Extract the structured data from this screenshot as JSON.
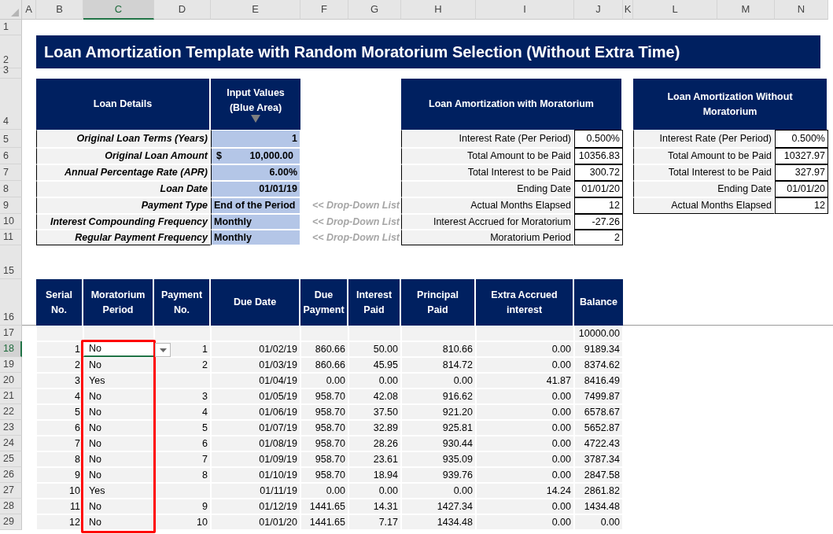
{
  "column_headers": [
    {
      "label": "A",
      "selected": false
    },
    {
      "label": "B",
      "selected": false
    },
    {
      "label": "C",
      "selected": true
    },
    {
      "label": "D",
      "selected": false
    },
    {
      "label": "E",
      "selected": false
    },
    {
      "label": "F",
      "selected": false
    },
    {
      "label": "G",
      "selected": false
    },
    {
      "label": "H",
      "selected": false
    },
    {
      "label": "I",
      "selected": false
    },
    {
      "label": "J",
      "selected": false
    },
    {
      "label": "K",
      "selected": false
    },
    {
      "label": "L",
      "selected": false
    },
    {
      "label": "M",
      "selected": false
    },
    {
      "label": "N",
      "selected": false
    }
  ],
  "row_headers": [
    {
      "label": "1",
      "selected": false
    },
    {
      "label": "2",
      "selected": false
    },
    {
      "label": "3",
      "selected": false
    },
    {
      "label": "4",
      "selected": false
    },
    {
      "label": "5",
      "selected": false
    },
    {
      "label": "6",
      "selected": false
    },
    {
      "label": "7",
      "selected": false
    },
    {
      "label": "8",
      "selected": false
    },
    {
      "label": "9",
      "selected": false
    },
    {
      "label": "10",
      "selected": false
    },
    {
      "label": "11",
      "selected": false
    },
    {
      "label": "15",
      "selected": false
    },
    {
      "label": "16",
      "selected": false
    },
    {
      "label": "17",
      "selected": false
    },
    {
      "label": "18",
      "selected": true
    },
    {
      "label": "19",
      "selected": false
    },
    {
      "label": "20",
      "selected": false
    },
    {
      "label": "21",
      "selected": false
    },
    {
      "label": "22",
      "selected": false
    },
    {
      "label": "23",
      "selected": false
    },
    {
      "label": "24",
      "selected": false
    },
    {
      "label": "25",
      "selected": false
    },
    {
      "label": "26",
      "selected": false
    },
    {
      "label": "27",
      "selected": false
    },
    {
      "label": "28",
      "selected": false
    },
    {
      "label": "29",
      "selected": false
    }
  ],
  "title": "Loan Amortization Template with Random Moratorium Selection (Without Extra Time)",
  "loan_details": {
    "header": "Loan Details",
    "input_header": [
      "Input Values",
      "(Blue Area)"
    ],
    "rows": [
      {
        "label": "Original Loan Terms (Years)",
        "value": "1"
      },
      {
        "label": "Original Loan Amount",
        "currency": "$",
        "value": "10,000.00"
      },
      {
        "label": "Annual Percentage Rate (APR)",
        "value": "6.00%"
      },
      {
        "label": "Loan Date",
        "value": "01/01/19"
      },
      {
        "label": "Payment Type",
        "value": "End of the Period",
        "note": "<< Drop-Down List"
      },
      {
        "label": "Interest Compounding Frequency",
        "value": "Monthly",
        "note": "<< Drop-Down List"
      },
      {
        "label": "Regular Payment Frequency",
        "value": "Monthly",
        "note": "<< Drop-Down List"
      }
    ]
  },
  "with_moratorium": {
    "title": "Loan Amortization with Moratorium",
    "rows": [
      {
        "label": "Interest Rate (Per Period)",
        "value": "0.500%"
      },
      {
        "label": "Total Amount to be Paid",
        "value": "10356.83"
      },
      {
        "label": "Total Interest to be Paid",
        "value": "300.72"
      },
      {
        "label": "Ending Date",
        "value": "01/01/20"
      },
      {
        "label": "Actual Months Elapsed",
        "value": "12"
      },
      {
        "label": "Interest Accrued for Moratorium",
        "value": "-27.26"
      },
      {
        "label": "Moratorium Period",
        "value": "2"
      }
    ]
  },
  "without_moratorium": {
    "title": "Loan Amortization Without Moratorium",
    "rows": [
      {
        "label": "Interest Rate (Per Period)",
        "value": "0.500%"
      },
      {
        "label": "Total Amount to be Paid",
        "value": "10327.97"
      },
      {
        "label": "Total Interest to be Paid",
        "value": "327.97"
      },
      {
        "label": "Ending Date",
        "value": "01/01/20"
      },
      {
        "label": "Actual Months Elapsed",
        "value": "12"
      }
    ]
  },
  "schedule": {
    "columns": [
      {
        "label": [
          "Serial",
          "No."
        ],
        "highlighted": false
      },
      {
        "label": [
          "Moratorium",
          "Period"
        ],
        "highlighted": true
      },
      {
        "label": [
          "Payment",
          "No."
        ],
        "highlighted": false
      },
      {
        "label": [
          "Due Date"
        ],
        "highlighted": false
      },
      {
        "label": [
          "Due",
          "Payment"
        ],
        "highlighted": false
      },
      {
        "label": [
          "Interest",
          "Paid"
        ],
        "highlighted": false
      },
      {
        "label": [
          "Principal",
          "Paid"
        ],
        "highlighted": false
      },
      {
        "label": [
          "Extra Accrued",
          "interest"
        ],
        "highlighted": false
      },
      {
        "label": [
          "Balance"
        ],
        "highlighted": false
      }
    ],
    "opening_balance": "10000.00",
    "rows": [
      {
        "selected": true,
        "cells": [
          "1",
          "No",
          "1",
          "01/02/19",
          "860.66",
          "50.00",
          "810.66",
          "0.00",
          "9189.34"
        ]
      },
      {
        "selected": false,
        "cells": [
          "2",
          "No",
          "2",
          "01/03/19",
          "860.66",
          "45.95",
          "814.72",
          "0.00",
          "8374.62"
        ]
      },
      {
        "selected": false,
        "cells": [
          "3",
          "Yes",
          "",
          "01/04/19",
          "0.00",
          "0.00",
          "0.00",
          "41.87",
          "8416.49"
        ]
      },
      {
        "selected": false,
        "cells": [
          "4",
          "No",
          "3",
          "01/05/19",
          "958.70",
          "42.08",
          "916.62",
          "0.00",
          "7499.87"
        ]
      },
      {
        "selected": false,
        "cells": [
          "5",
          "No",
          "4",
          "01/06/19",
          "958.70",
          "37.50",
          "921.20",
          "0.00",
          "6578.67"
        ]
      },
      {
        "selected": false,
        "cells": [
          "6",
          "No",
          "5",
          "01/07/19",
          "958.70",
          "32.89",
          "925.81",
          "0.00",
          "5652.87"
        ]
      },
      {
        "selected": false,
        "cells": [
          "7",
          "No",
          "6",
          "01/08/19",
          "958.70",
          "28.26",
          "930.44",
          "0.00",
          "4722.43"
        ]
      },
      {
        "selected": false,
        "cells": [
          "8",
          "No",
          "7",
          "01/09/19",
          "958.70",
          "23.61",
          "935.09",
          "0.00",
          "3787.34"
        ]
      },
      {
        "selected": false,
        "cells": [
          "9",
          "No",
          "8",
          "01/10/19",
          "958.70",
          "18.94",
          "939.76",
          "0.00",
          "2847.58"
        ]
      },
      {
        "selected": false,
        "cells": [
          "10",
          "Yes",
          "",
          "01/11/19",
          "0.00",
          "0.00",
          "0.00",
          "14.24",
          "2861.82"
        ]
      },
      {
        "selected": false,
        "cells": [
          "11",
          "No",
          "9",
          "01/12/19",
          "1441.65",
          "14.31",
          "1427.34",
          "0.00",
          "1434.48"
        ]
      },
      {
        "selected": false,
        "cells": [
          "12",
          "No",
          "10",
          "01/01/20",
          "1441.65",
          "7.17",
          "1434.48",
          "0.00",
          "0.00"
        ]
      }
    ]
  }
}
